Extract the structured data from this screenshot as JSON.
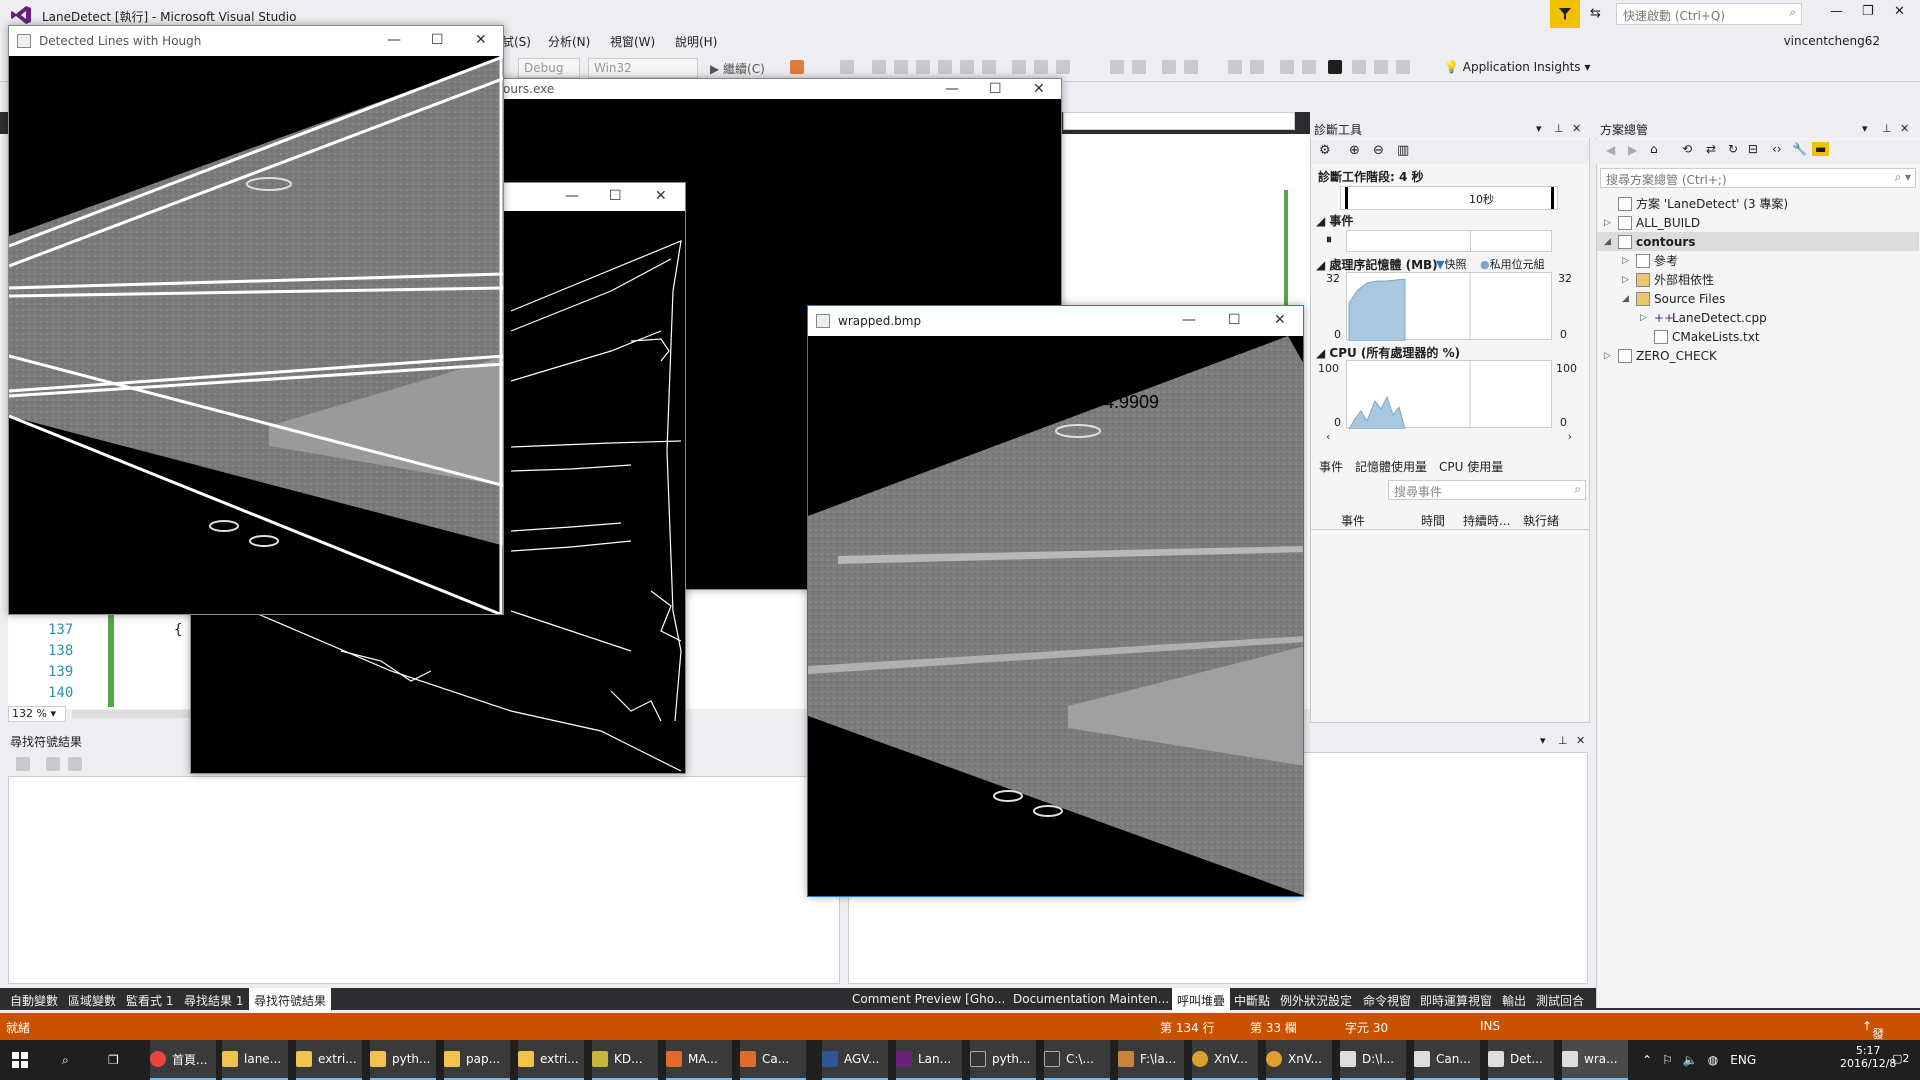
{
  "vs": {
    "title": "LaneDetect [執行] - Microsoft Visual Studio",
    "quick_launch_placeholder": "快速啟動 (Ctrl+Q)",
    "user": "vincentcheng62",
    "menu": {
      "debug": "試(S)",
      "analyze": "分析(N)",
      "window": "視窗(W)",
      "help": "說明(H)"
    },
    "toolbar": {
      "config": "Debug",
      "platform": "Win32",
      "continue": "繼續(C)",
      "app_insights": "Application Insights"
    },
    "line_numbers": [
      "137",
      "138",
      "139",
      "140"
    ],
    "code_brace": "{",
    "zoom": "132 %"
  },
  "find_panel": {
    "title": "尋找符號結果"
  },
  "bottom_tabs_left": [
    "自動變數",
    "區域變數",
    "監看式 1",
    "尋找結果 1",
    "尋找符號結果"
  ],
  "bottom_tabs_right": [
    "Comment Preview [Gho...",
    "Documentation Mainten...",
    "呼叫堆疊",
    "中斷點",
    "例外狀況設定",
    "命令視窗",
    "即時運算視窗",
    "輸出",
    "測試回合"
  ],
  "status": {
    "ready": "就緒",
    "line": "第 134 行",
    "col": "第 33 欄",
    "char": "字元 30",
    "ins": "INS",
    "publish": "發行"
  },
  "diag": {
    "title": "診斷工具",
    "session": "診斷工作階段: 4 秒",
    "timeline_mark": "10秒",
    "events": "事件",
    "memory": "處理序記憶體 (MB)",
    "snapshot": "快照",
    "private_bytes": "私用位元組",
    "mem_max": "32",
    "mem_min": "0",
    "cpu": "CPU (所有處理器的 %)",
    "cpu_max": "100",
    "cpu_min": "0",
    "tabs": [
      "事件",
      "記憶體使用量",
      "CPU 使用量"
    ],
    "search_placeholder": "搜尋事件",
    "cols": [
      "事件",
      "時間",
      "持續時...",
      "執行緒"
    ]
  },
  "solution": {
    "title": "方案總管",
    "search_placeholder": "搜尋方案總管 (Ctrl+;)",
    "items": [
      {
        "label": "方案 'LaneDetect' (3 專案)"
      },
      {
        "label": "ALL_BUILD"
      },
      {
        "label": "contours"
      },
      {
        "label": "參考"
      },
      {
        "label": "外部相依性"
      },
      {
        "label": "Source Files"
      },
      {
        "label": "LaneDetect.cpp"
      },
      {
        "label": "CMakeLists.txt"
      },
      {
        "label": "ZERO_CHECK"
      }
    ]
  },
  "windows": {
    "hough": "Detected Lines with Hough",
    "contours": "ours.exe",
    "wrapped": "wrapped.bmp",
    "wrapped_overlay_text": "4.9909"
  },
  "taskbar": {
    "items": [
      "首頁...",
      "lane...",
      "extri...",
      "pyth...",
      "pap...",
      "extri...",
      "KD...",
      "MA...",
      "Ca...",
      "AGV...",
      "Lan...",
      "pyth...",
      "C:\\...",
      "F:\\la...",
      "XnV...",
      "XnV...",
      "D:\\l...",
      "Can...",
      "Det...",
      "wra..."
    ],
    "lang": "ENG",
    "time": "5:17",
    "date": "2016/12/8",
    "notif": "2"
  },
  "colors": {
    "status_bar": "#ca5100",
    "accent": "#007acc",
    "chart_fill": "#a9c8e0"
  }
}
